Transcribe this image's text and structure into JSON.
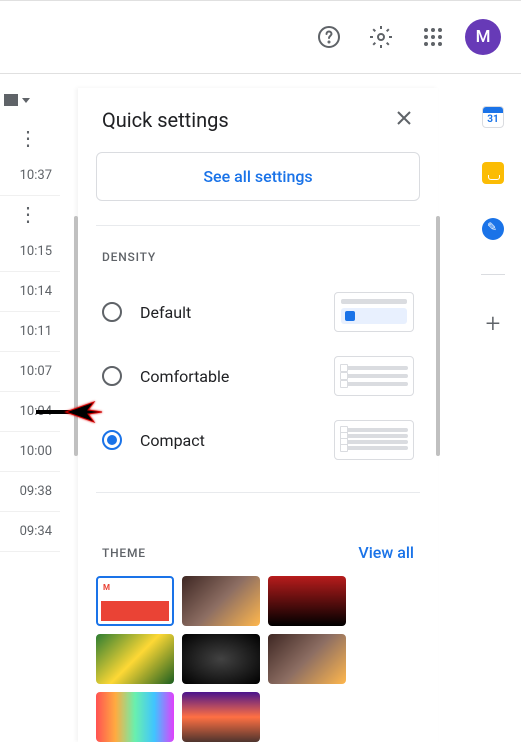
{
  "topbar": {
    "avatar_letter": "M"
  },
  "mail": {
    "times": [
      "10:37",
      "10:15",
      "10:14",
      "10:11",
      "10:07",
      "10:04",
      "10:00",
      "09:38",
      "09:34"
    ]
  },
  "panel": {
    "title": "Quick settings",
    "see_all": "See all settings",
    "density_label": "DENSITY",
    "options": {
      "default": "Default",
      "comfortable": "Comfortable",
      "compact": "Compact"
    },
    "selected": "compact",
    "theme_label": "THEME",
    "view_all": "View all"
  }
}
